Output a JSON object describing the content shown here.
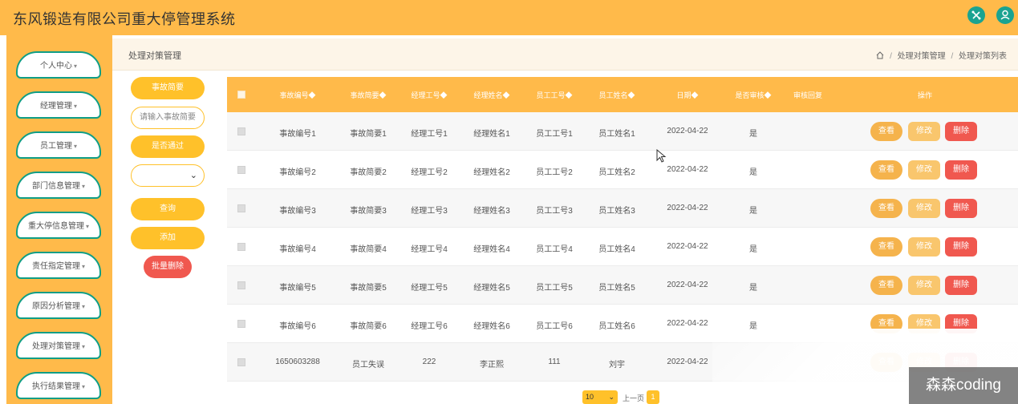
{
  "app": {
    "title": "东风锻造有限公司重大停管理系统"
  },
  "header_icons": [
    "share-icon",
    "user-icon"
  ],
  "sidebar": {
    "items": [
      {
        "label": "个人中心"
      },
      {
        "label": "经理管理"
      },
      {
        "label": "员工管理"
      },
      {
        "label": "部门信息管理"
      },
      {
        "label": "重大停信息管理"
      },
      {
        "label": "责任指定管理"
      },
      {
        "label": "原因分析管理"
      },
      {
        "label": "处理对策管理"
      },
      {
        "label": "执行结果管理"
      }
    ]
  },
  "breadcrumb": {
    "page_title": "处理对策管理",
    "items": [
      "处理对策管理",
      "处理对策列表"
    ]
  },
  "filter": {
    "label_1": "事故简要",
    "input_placeholder": "请输入事故简要",
    "label_2": "是否通过",
    "select_value": "",
    "search_button": "查询",
    "add_button": "添加",
    "batch_delete_button": "批量删除"
  },
  "table": {
    "columns": [
      "事故编号",
      "事故简要",
      "经理工号",
      "经理姓名",
      "员工工号",
      "员工姓名",
      "日期",
      "是否审核",
      "审核回复",
      "操作"
    ],
    "rows": [
      {
        "no": "事故编号1",
        "summary": "事故简要1",
        "mgr_id": "经理工号1",
        "mgr_name": "经理姓名1",
        "emp_id": "员工工号1",
        "emp_name": "员工姓名1",
        "date": "2022-04-22",
        "audited": "是",
        "reply": ""
      },
      {
        "no": "事故编号2",
        "summary": "事故简要2",
        "mgr_id": "经理工号2",
        "mgr_name": "经理姓名2",
        "emp_id": "员工工号2",
        "emp_name": "员工姓名2",
        "date": "2022-04-22",
        "audited": "是",
        "reply": ""
      },
      {
        "no": "事故编号3",
        "summary": "事故简要3",
        "mgr_id": "经理工号3",
        "mgr_name": "经理姓名3",
        "emp_id": "员工工号3",
        "emp_name": "员工姓名3",
        "date": "2022-04-22",
        "audited": "是",
        "reply": ""
      },
      {
        "no": "事故编号4",
        "summary": "事故简要4",
        "mgr_id": "经理工号4",
        "mgr_name": "经理姓名4",
        "emp_id": "员工工号4",
        "emp_name": "员工姓名4",
        "date": "2022-04-22",
        "audited": "是",
        "reply": ""
      },
      {
        "no": "事故编号5",
        "summary": "事故简要5",
        "mgr_id": "经理工号5",
        "mgr_name": "经理姓名5",
        "emp_id": "员工工号5",
        "emp_name": "员工姓名5",
        "date": "2022-04-22",
        "audited": "是",
        "reply": ""
      },
      {
        "no": "事故编号6",
        "summary": "事故简要6",
        "mgr_id": "经理工号6",
        "mgr_name": "经理姓名6",
        "emp_id": "员工工号6",
        "emp_name": "员工姓名6",
        "date": "2022-04-22",
        "audited": "是",
        "reply": ""
      },
      {
        "no": "1650603288",
        "summary": "员工失误",
        "mgr_id": "222",
        "mgr_name": "李正熙",
        "emp_id": "111",
        "emp_name": "刘宇",
        "date": "2022-04-22",
        "audited": "",
        "reply": ""
      }
    ],
    "actions": {
      "view": "查看",
      "edit": "修改",
      "delete": "删除"
    }
  },
  "pagination": {
    "page_size": "10",
    "prev_label": "上一页",
    "current_page": "1"
  },
  "watermark": "森森coding",
  "colors": {
    "primary": "#ffba4a",
    "accent_teal": "#0f9e86",
    "danger": "#f0584f",
    "button_yellow": "#ffc12a"
  }
}
